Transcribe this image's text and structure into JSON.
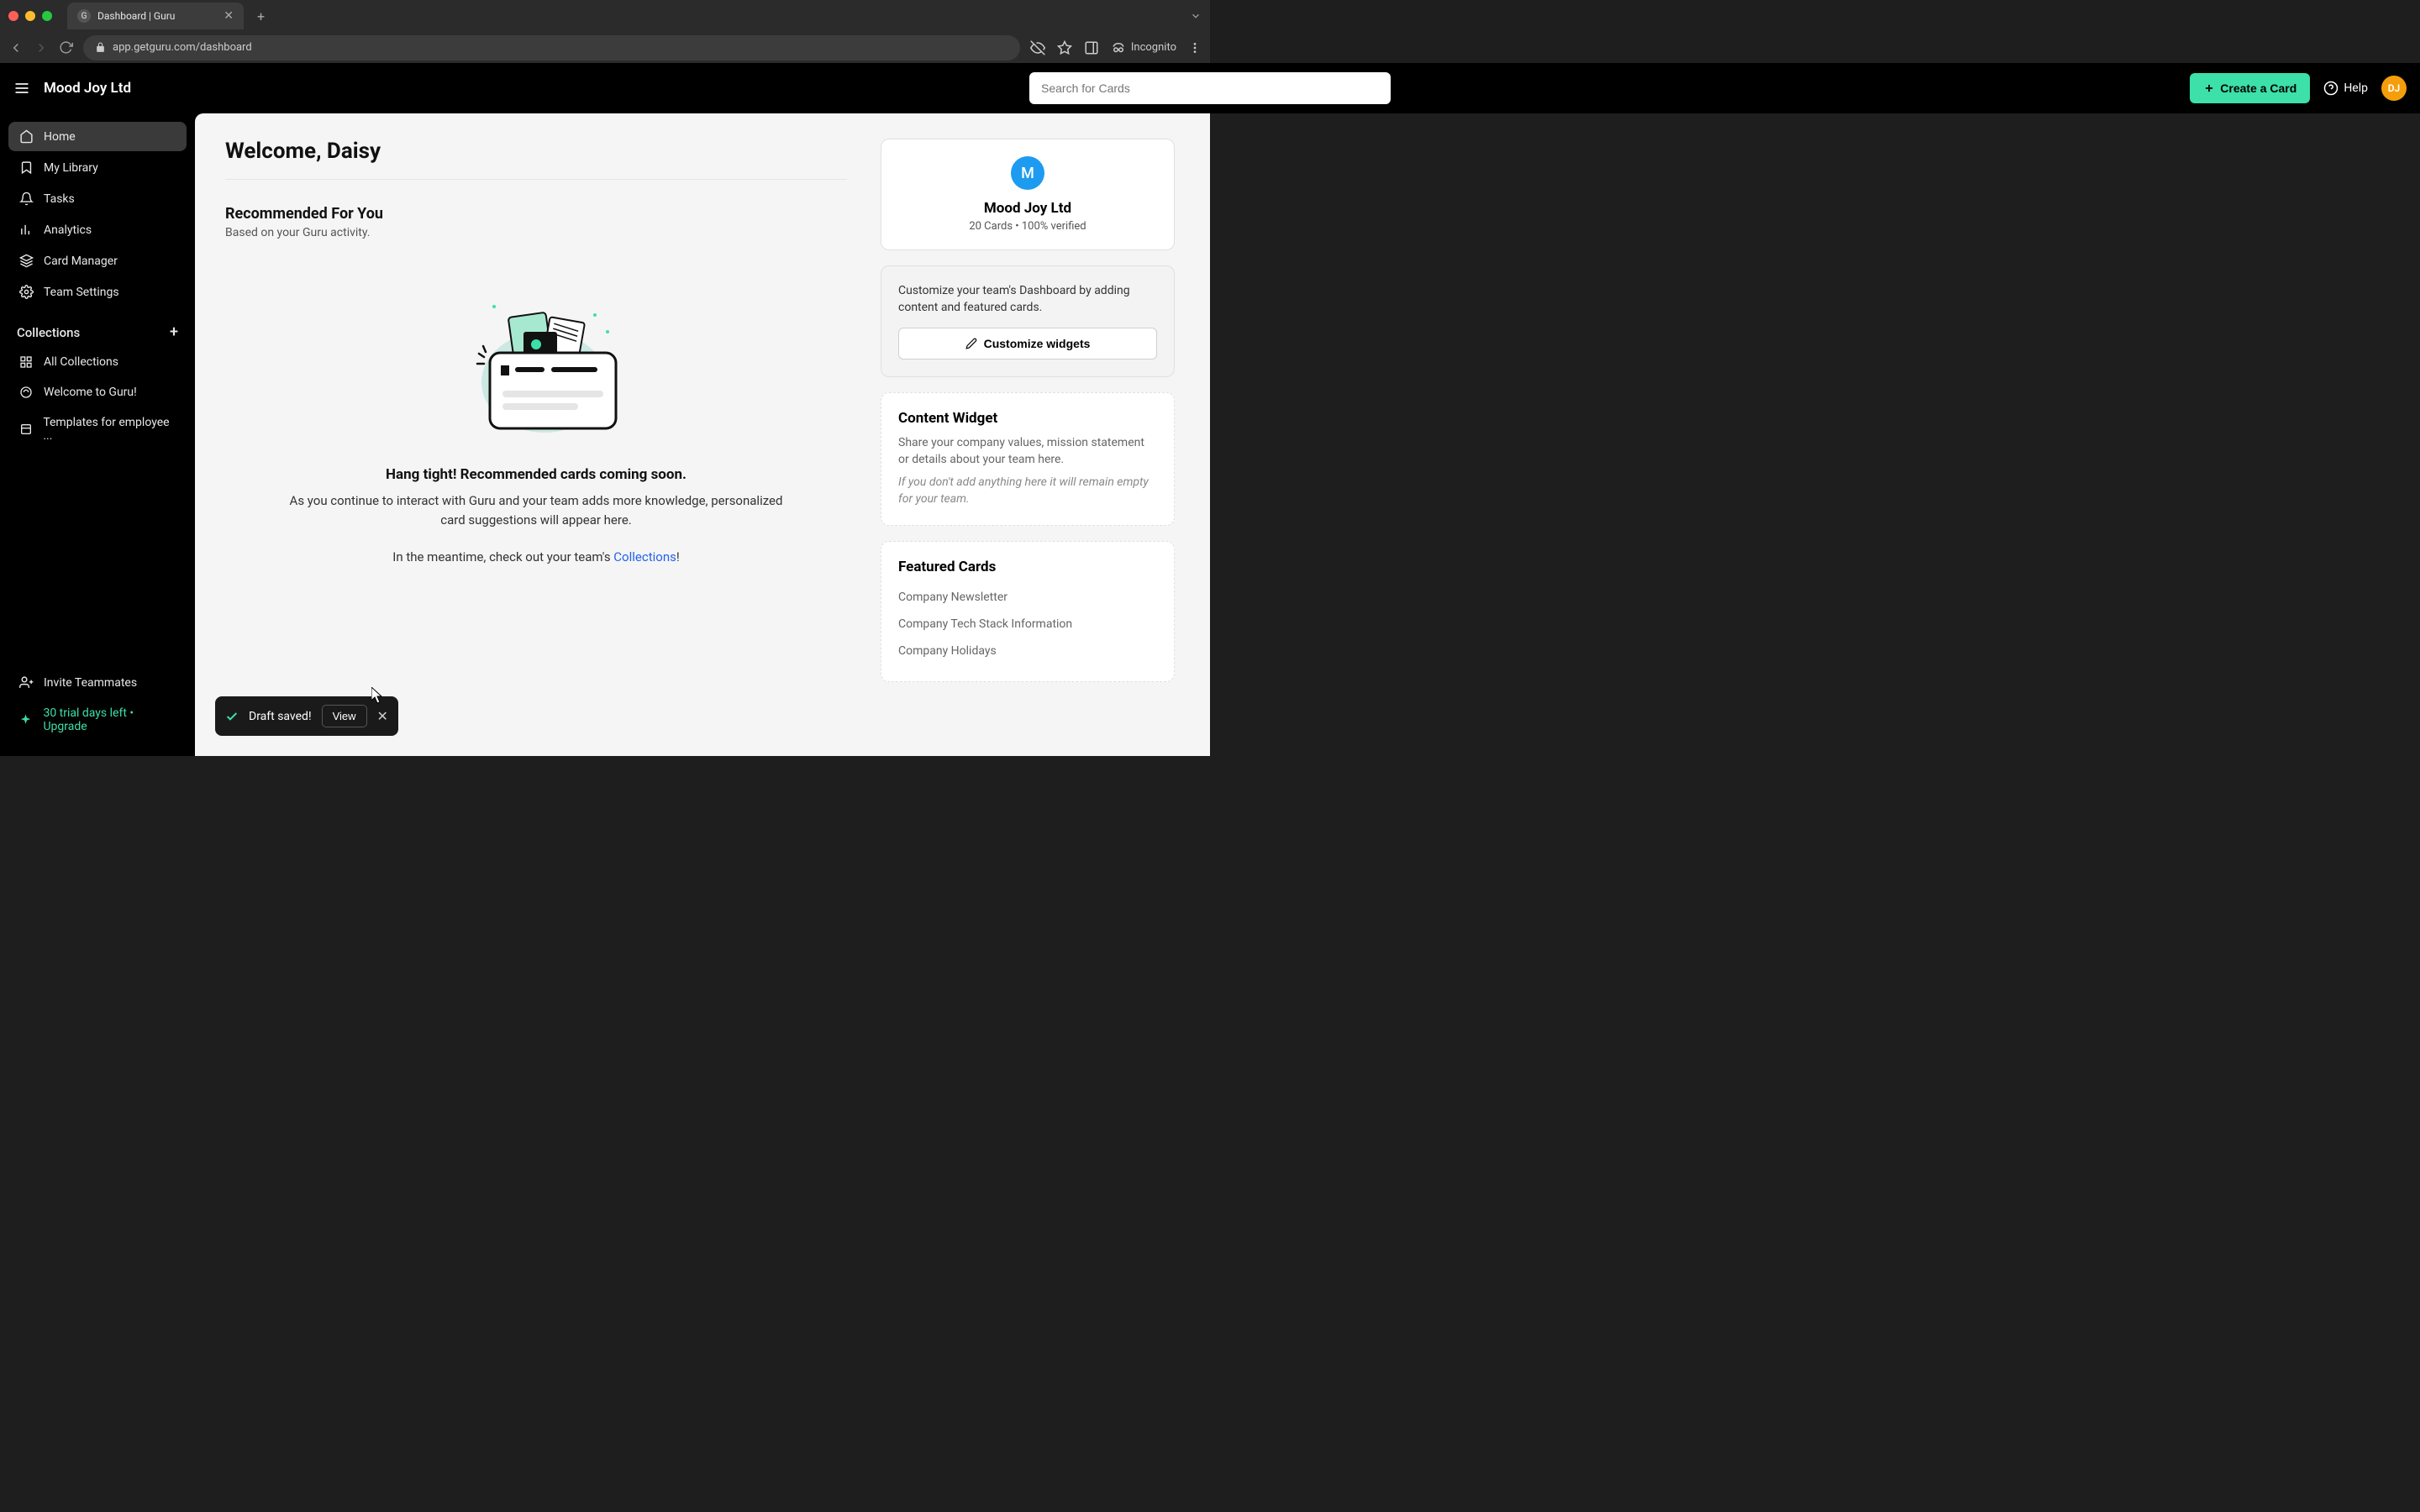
{
  "browser": {
    "tab_title": "Dashboard | Guru",
    "url": "app.getguru.com/dashboard",
    "incognito_label": "Incognito"
  },
  "header": {
    "workspace": "Mood Joy Ltd",
    "search_placeholder": "Search for Cards",
    "create_label": "Create a Card",
    "help_label": "Help",
    "avatar_initials": "DJ"
  },
  "sidebar": {
    "items": [
      {
        "label": "Home"
      },
      {
        "label": "My Library"
      },
      {
        "label": "Tasks"
      },
      {
        "label": "Analytics"
      },
      {
        "label": "Card Manager"
      },
      {
        "label": "Team Settings"
      }
    ],
    "collections_header": "Collections",
    "collections": [
      {
        "label": "All Collections"
      },
      {
        "label": "Welcome to Guru!"
      },
      {
        "label": "Templates for employee ..."
      }
    ],
    "invite_label": "Invite Teammates",
    "trial_text": "30 trial days left • Upgrade"
  },
  "main": {
    "welcome": "Welcome, Daisy",
    "rec_title": "Recommended For You",
    "rec_subtitle": "Based on your Guru activity.",
    "empty_title": "Hang tight! Recommended cards coming soon.",
    "empty_desc": "As you continue to interact with Guru and your team adds more knowledge, personalized card suggestions will appear here.",
    "empty_cta_prefix": "In the meantime, check out your team's ",
    "empty_cta_link": "Collections",
    "empty_cta_suffix": "!"
  },
  "right": {
    "org_initial": "M",
    "org_name": "Mood Joy Ltd",
    "org_stats": "20 Cards • 100% verified",
    "customize_text": "Customize your team's Dashboard by adding content and featured cards.",
    "customize_btn": "Customize widgets",
    "content_widget_title": "Content Widget",
    "content_widget_desc": "Share your company values, mission statement or details about your team here.",
    "content_widget_hint": "If you don't add anything here it will remain empty for your team.",
    "featured_title": "Featured Cards",
    "featured": [
      "Company Newsletter",
      "Company Tech Stack Information",
      "Company Holidays"
    ]
  },
  "toast": {
    "message": "Draft saved!",
    "view_label": "View"
  }
}
